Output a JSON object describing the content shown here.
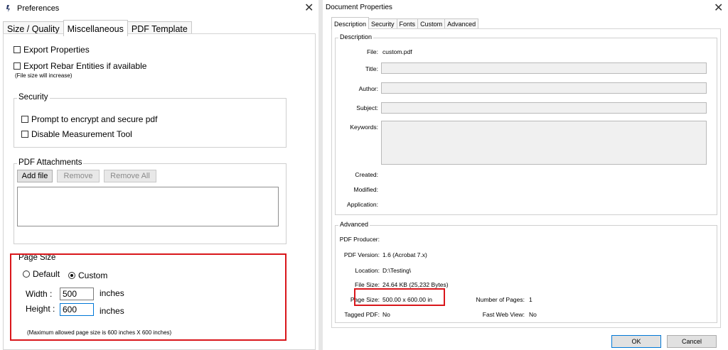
{
  "preferences": {
    "title": "Preferences",
    "close": "✕",
    "tabs": [
      "Size / Quality",
      "Miscellaneous",
      "PDF Template"
    ],
    "export_properties": "Export Properties",
    "export_rebar": "Export Rebar Entities if available",
    "file_size_note": "(File size will increase)",
    "security": {
      "label": "Security",
      "prompt_encrypt": "Prompt to encrypt and secure pdf",
      "disable_measure": "Disable Measurement Tool"
    },
    "attachments": {
      "label": "PDF Attachments",
      "add_file": "Add file",
      "remove": "Remove",
      "remove_all": "Remove All"
    },
    "page_size": {
      "label": "Page Size",
      "default": "Default",
      "custom": "Custom",
      "width_label": "Width  :",
      "width_value": "500",
      "height_label": "Height :",
      "height_value": "600",
      "unit": "inches",
      "note": "(Maximum allowed page size is 600 inches X 600 inches)"
    }
  },
  "document_properties": {
    "title": "Document Properties",
    "close": "✕",
    "tabs": [
      "Description",
      "Security",
      "Fonts",
      "Custom",
      "Advanced"
    ],
    "description_group": "Description",
    "file_label": "File:",
    "file_value": "custom.pdf",
    "title_label": "Title:",
    "author_label": "Author:",
    "subject_label": "Subject:",
    "keywords_label": "Keywords:",
    "created_label": "Created:",
    "modified_label": "Modified:",
    "application_label": "Application:",
    "advanced_group": "Advanced",
    "producer_label": "PDF Producer:",
    "version_label": "PDF Version:",
    "version_value": "1.6 (Acrobat 7.x)",
    "location_label": "Location:",
    "location_value": "D:\\Testing\\",
    "filesize_label": "File Size:",
    "filesize_value": "24.64 KB (25,232 Bytes)",
    "pagesize_label": "Page Size:",
    "pagesize_value": "500.00 x 600.00 in",
    "numpages_label": "Number of Pages:",
    "numpages_value": "1",
    "tagged_label": "Tagged PDF:",
    "tagged_value": "No",
    "fastweb_label": "Fast Web View:",
    "fastweb_value": "No",
    "ok": "OK",
    "cancel": "Cancel"
  },
  "colors": {
    "highlight": "#d9161b",
    "focus": "#0078d7"
  }
}
